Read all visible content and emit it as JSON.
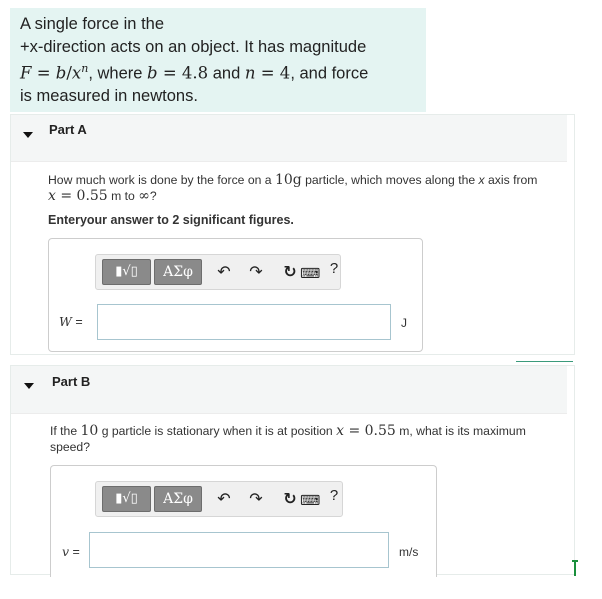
{
  "intro": {
    "line1": "A single force in the",
    "line2": "+x-direction acts on an object. It has magnitude",
    "f_var": "F",
    "eq": " = ",
    "b_var": "b",
    "slash": "/",
    "x_var": "x",
    "n_sup": "n",
    "where_text": ", where ",
    "b_var2": "b",
    "b_eq": " = 4.8",
    "and_text": " and ",
    "n_var": "n",
    "n_eq": " = 4",
    "and_force": ", and force",
    "line4": "is measured in newtons."
  },
  "part_a": {
    "title": "Part A",
    "q_pre": "How much work is done by the force on a ",
    "q_mass": "10g",
    "q_mid": " particle, which moves along the ",
    "q_x": "x",
    "q_post": " axis from",
    "q2_x": "x",
    "q2_eq": " = 0.55",
    "q2_unit": " m to ",
    "q2_inf": "∞",
    "q2_end": "?",
    "instruction": "Enteryour answer to 2 significant figures.",
    "toolbar": {
      "templates_icon": "▮√▯",
      "greek_label": "ΑΣφ",
      "undo_icon": "↶",
      "redo_icon": "↷",
      "reset_icon": "↻",
      "keyboard_icon": "⌨",
      "help_label": "?"
    },
    "answer_var": "W",
    "answer_eq": " =",
    "answer_value": "",
    "answer_unit": "J"
  },
  "part_b": {
    "title": "Part B",
    "q_pre": "If the ",
    "q_mass": "10",
    "q_mid": " g particle is stationary when it is at position ",
    "q_x": "x",
    "q_eq": " = 0.55",
    "q_post": " m, what is its maximum",
    "q_line2": "speed?",
    "toolbar": {
      "templates_icon": "▮√▯",
      "greek_label": "ΑΣφ",
      "undo_icon": "↶",
      "redo_icon": "↷",
      "reset_icon": "↻",
      "keyboard_icon": "⌨",
      "help_label": "?"
    },
    "answer_var": "v",
    "answer_eq": " =",
    "answer_value": "",
    "answer_unit": "m/s"
  },
  "colors": {
    "intro_bg": "#e4f4f2",
    "input_border": "#a7c5cf",
    "toolbar_button": "#8a8a8a",
    "accent_green": "#1a8f3c"
  }
}
